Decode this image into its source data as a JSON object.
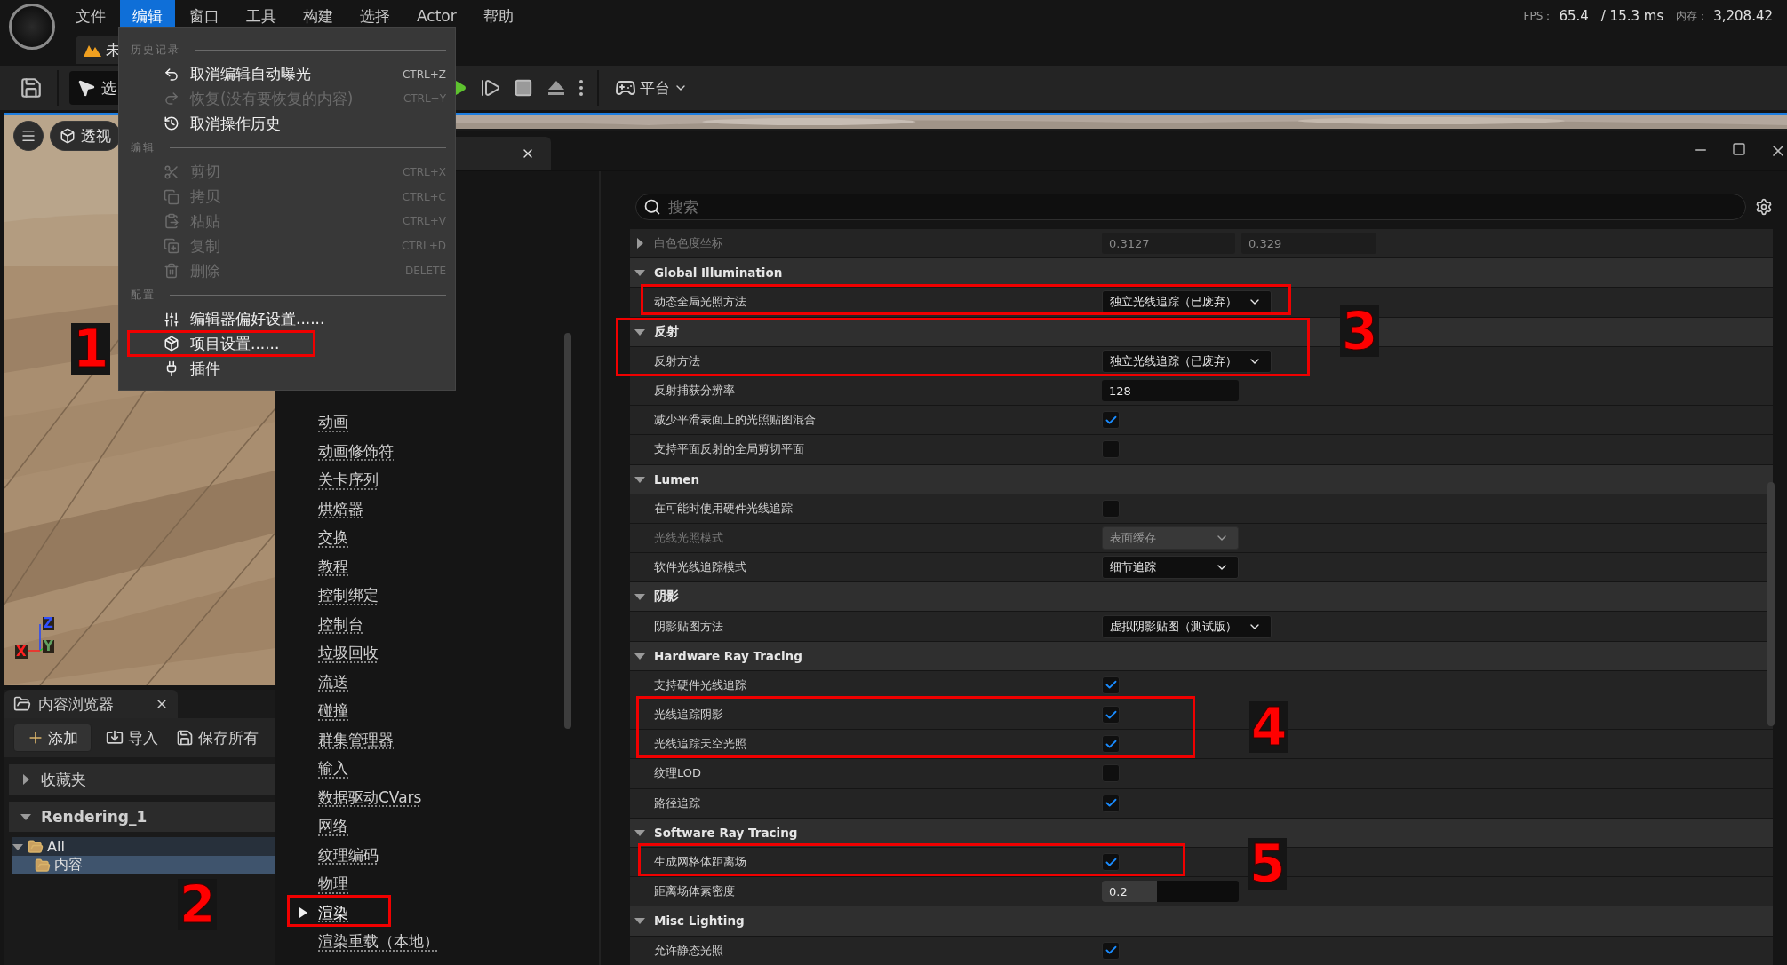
{
  "menubar": {
    "items": [
      {
        "label": "文件",
        "selected": false
      },
      {
        "label": "编辑",
        "selected": true
      },
      {
        "label": "窗口",
        "selected": false
      },
      {
        "label": "工具",
        "selected": false
      },
      {
        "label": "构建",
        "selected": false
      },
      {
        "label": "选择",
        "selected": false
      },
      {
        "label": "Actor",
        "selected": false
      },
      {
        "label": "帮助",
        "selected": false
      }
    ],
    "stats": {
      "fps_label": "FPS：",
      "fps": "65.4",
      "frame_time": "/ 15.3 ms",
      "memory_label": "内存：",
      "memory": "3,208.42"
    }
  },
  "level_tab": {
    "label": "未"
  },
  "toolbar": {
    "mode_button": "选",
    "platform_button": "平台"
  },
  "viewport": {
    "view_button": "透视",
    "axes": [
      "Z",
      "Y",
      "X"
    ]
  },
  "content_browser": {
    "title": "内容浏览器",
    "actions": [
      "添加",
      "导入",
      "保存所有"
    ],
    "sections": [
      {
        "label": "收藏夹",
        "expanded": false
      },
      {
        "label": "Rendering_1",
        "expanded": true
      }
    ],
    "tree": [
      {
        "label": "All",
        "expanded": true,
        "selected": false,
        "children": [
          {
            "label": "内容",
            "selected": true
          }
        ]
      }
    ]
  },
  "settings_window": {
    "nav": {
      "items": [
        {
          "label": "动画",
          "selected": false
        },
        {
          "label": "动画修饰符",
          "selected": false
        },
        {
          "label": "关卡序列",
          "selected": false
        },
        {
          "label": "烘焙器",
          "selected": false
        },
        {
          "label": "交换",
          "selected": false
        },
        {
          "label": "教程",
          "selected": false
        },
        {
          "label": "控制绑定",
          "selected": false
        },
        {
          "label": "控制台",
          "selected": false
        },
        {
          "label": "垃圾回收",
          "selected": false
        },
        {
          "label": "流送",
          "selected": false
        },
        {
          "label": "碰撞",
          "selected": false
        },
        {
          "label": "群集管理器",
          "selected": false
        },
        {
          "label": "输入",
          "selected": false
        },
        {
          "label": "数据驱动CVars",
          "selected": false
        },
        {
          "label": "网络",
          "selected": false
        },
        {
          "label": "纹理编码",
          "selected": false
        },
        {
          "label": "物理",
          "selected": false
        },
        {
          "label": "渲染",
          "selected": true
        },
        {
          "label": "渲染重载（本地）",
          "selected": false
        }
      ]
    },
    "search": {
      "placeholder": "搜索"
    },
    "rows": [
      {
        "kind": "vector",
        "label": "白色色度坐标",
        "expanded": false,
        "disabled": true,
        "values": [
          "0.3127",
          "0.329"
        ]
      },
      {
        "kind": "category",
        "label": "Global Illumination",
        "expanded": true
      },
      {
        "kind": "dropdown",
        "label": "动态全局光照方法",
        "value": "独立光线追踪（已废弃）",
        "disabled": false
      },
      {
        "kind": "category",
        "label": "反射",
        "expanded": true
      },
      {
        "kind": "dropdown",
        "label": "反射方法",
        "value": "独立光线追踪（已废弃）",
        "disabled": false
      },
      {
        "kind": "number",
        "label": "反射捕获分辨率",
        "value": "128",
        "disabled": false
      },
      {
        "kind": "checkbox",
        "label": "减少平滑表面上的光照贴图混合",
        "checked": true,
        "disabled": false
      },
      {
        "kind": "checkbox",
        "label": "支持平面反射的全局剪切平面",
        "checked": false,
        "disabled": false
      },
      {
        "kind": "category",
        "label": "Lumen",
        "expanded": true
      },
      {
        "kind": "checkbox",
        "label": "在可能时使用硬件光线追踪",
        "checked": false,
        "disabled": false
      },
      {
        "kind": "dropdown",
        "label": "光线光照模式",
        "value": "表面缓存",
        "disabled": true
      },
      {
        "kind": "dropdown",
        "label": "软件光线追踪模式",
        "value": "细节追踪",
        "disabled": false
      },
      {
        "kind": "category",
        "label": "阴影",
        "expanded": true
      },
      {
        "kind": "dropdown",
        "label": "阴影贴图方法",
        "value": "虚拟阴影贴图（测试版）",
        "disabled": false
      },
      {
        "kind": "category",
        "label": "Hardware Ray Tracing",
        "expanded": true
      },
      {
        "kind": "checkbox",
        "label": "支持硬件光线追踪",
        "checked": true,
        "disabled": false
      },
      {
        "kind": "checkbox",
        "label": "光线追踪阴影",
        "checked": true,
        "disabled": false
      },
      {
        "kind": "checkbox",
        "label": "光线追踪天空光照",
        "checked": true,
        "disabled": false
      },
      {
        "kind": "checkbox",
        "label": "纹理LOD",
        "checked": false,
        "disabled": false
      },
      {
        "kind": "checkbox",
        "label": "路径追踪",
        "checked": true,
        "disabled": false
      },
      {
        "kind": "category",
        "label": "Software Ray Tracing",
        "expanded": true
      },
      {
        "kind": "checkbox",
        "label": "生成网格体距离场",
        "checked": true,
        "disabled": false
      },
      {
        "kind": "slider",
        "label": "距离场体素密度",
        "value": "0.2",
        "level": 0.4,
        "disabled": false
      },
      {
        "kind": "category",
        "label": "Misc Lighting",
        "expanded": true
      },
      {
        "kind": "checkbox",
        "label": "允许静态光照",
        "checked": true,
        "disabled": false
      }
    ]
  },
  "edit_menu": {
    "sections": [
      {
        "heading": "历史记录",
        "items": [
          {
            "label": "取消编辑自动曝光",
            "shortcut": "CTRL+Z",
            "disabled": false
          },
          {
            "label": "恢复(没有要恢复的内容)",
            "shortcut": "CTRL+Y",
            "disabled": true
          },
          {
            "label": "取消操作历史",
            "disabled": false
          }
        ]
      },
      {
        "heading": "编辑",
        "items": [
          {
            "label": "剪切",
            "shortcut": "CTRL+X",
            "disabled": true
          },
          {
            "label": "拷贝",
            "shortcut": "CTRL+C",
            "disabled": true
          },
          {
            "label": "粘贴",
            "shortcut": "CTRL+V",
            "disabled": true
          },
          {
            "label": "复制",
            "shortcut": "CTRL+D",
            "disabled": true
          },
          {
            "label": "删除",
            "shortcut": "DELETE",
            "disabled": true
          }
        ]
      },
      {
        "heading": "配置",
        "items": [
          {
            "label": "编辑器偏好设置......",
            "disabled": false
          },
          {
            "label": "项目设置......",
            "disabled": false
          },
          {
            "label": "插件",
            "disabled": false
          }
        ]
      }
    ]
  },
  "annotations": [
    {
      "label": "1"
    },
    {
      "label": "2"
    },
    {
      "label": "3"
    },
    {
      "label": "4"
    },
    {
      "label": "5"
    }
  ]
}
